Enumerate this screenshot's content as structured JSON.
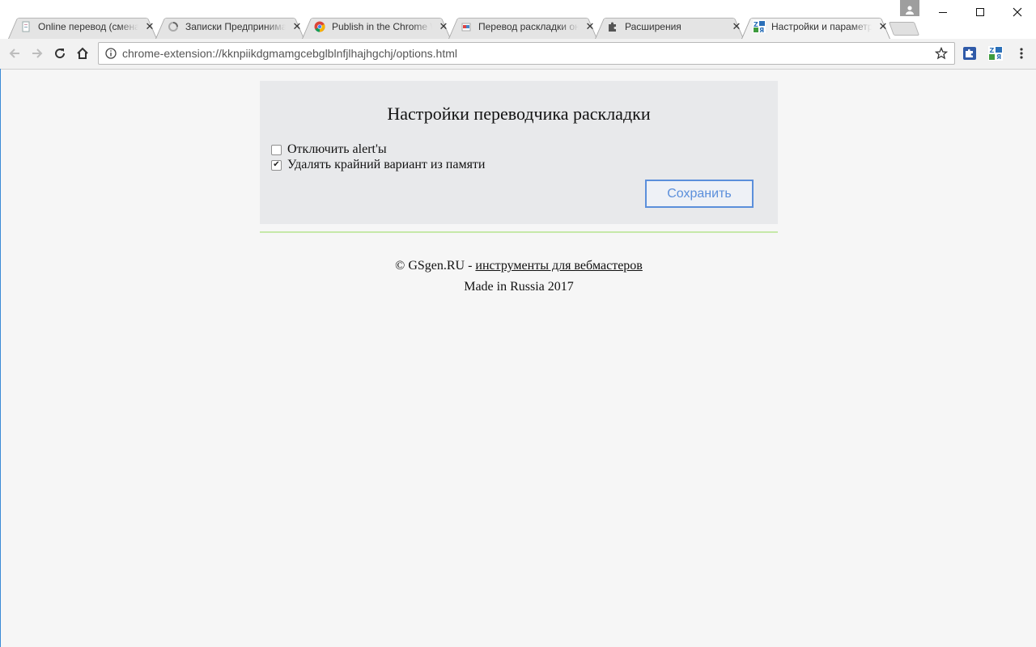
{
  "browser": {
    "tabs": [
      {
        "title": "Online перевод (смена раскладки)",
        "icon": "page-icon",
        "active": false
      },
      {
        "title": "Записки Предпринимателя",
        "icon": "loading-icon",
        "active": false
      },
      {
        "title": "Publish in the Chrome Web Store",
        "icon": "chrome-icon",
        "active": false
      },
      {
        "title": "Перевод раскладки онлайн",
        "icon": "page-icon",
        "active": false
      },
      {
        "title": "Расширения",
        "icon": "puzzle-icon",
        "active": false
      },
      {
        "title": "Настройки и параметры",
        "icon": "translate-icon",
        "active": true
      }
    ],
    "url": "chrome-extension://kknpiikdgmamgcebglblnfjlhajhgchj/options.html",
    "accent_color": "#5b8fdb"
  },
  "options": {
    "title": "Настройки переводчика раскладки",
    "items": [
      {
        "label": "Отключить alert'ы",
        "checked": false
      },
      {
        "label": "Удалять крайний вариант из памяти",
        "checked": true
      }
    ],
    "save_label": "Сохранить"
  },
  "footer": {
    "copyright_prefix": "© GSgen.RU - ",
    "link_text": "инструменты для вебмастеров",
    "made_in": "Made in Russia 2017"
  }
}
